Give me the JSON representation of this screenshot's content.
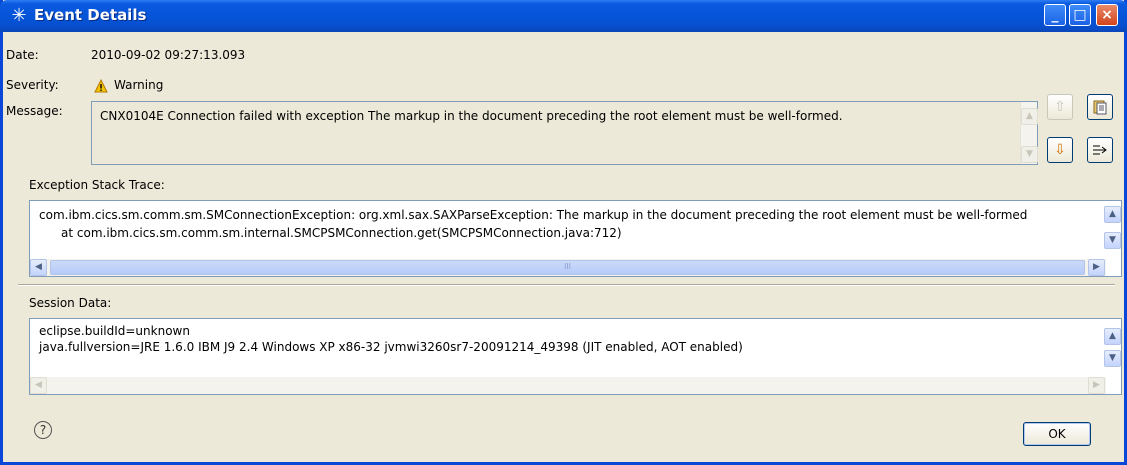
{
  "window": {
    "title": "Event Details"
  },
  "fields": {
    "date_label": "Date:",
    "date_value": "2010-09-02 09:27:13.093",
    "severity_label": "Severity:",
    "severity_value": "Warning",
    "message_label": "Message:",
    "message_value": "CNX0104E Connection failed with exception The markup in the document preceding the root element must be well-formed."
  },
  "stack": {
    "label": "Exception Stack Trace:",
    "lines": [
      "com.ibm.cics.sm.comm.sm.SMConnectionException: org.xml.sax.SAXParseException: The markup in the document preceding the root element must be well-formed",
      "at com.ibm.cics.sm.comm.sm.internal.SMCPSMConnection.get(SMCPSMConnection.java:712)"
    ],
    "hscroll_thumb_text": "III"
  },
  "session": {
    "label": "Session Data:",
    "lines": [
      "eclipse.buildId=unknown",
      "java.fullversion=JRE 1.6.0 IBM J9 2.4 Windows XP x86-32 jvmwi3260sr7-20091214_49398 (JIT enabled, AOT enabled)"
    ]
  },
  "buttons": {
    "ok": "OK",
    "help": "?"
  },
  "icons": {
    "title": "asterisk-icon",
    "severity": "warning-icon",
    "previous": "arrow-up-icon",
    "next": "arrow-down-icon",
    "copy": "clipboard-icon",
    "filter": "filter-icon"
  },
  "colors": {
    "titlebar": "#0654d8",
    "dialog_bg": "#ece9d8",
    "warning": "#e8a800"
  }
}
